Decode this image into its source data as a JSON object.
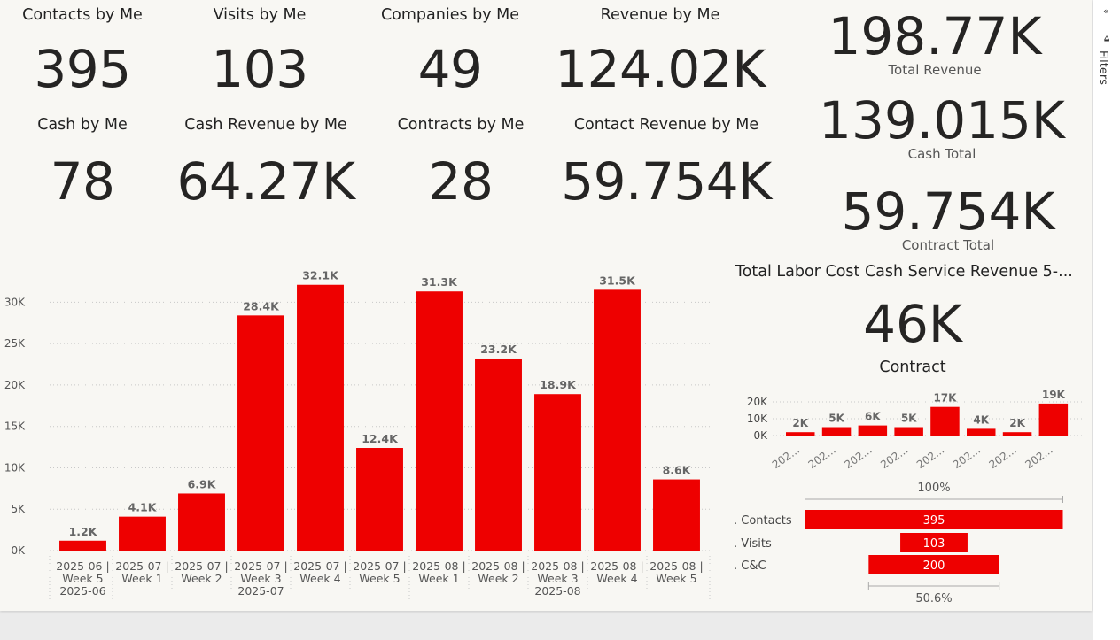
{
  "kpis": [
    {
      "title": "Contacts by Me",
      "value": "395"
    },
    {
      "title": "Visits by Me",
      "value": "103"
    },
    {
      "title": "Companies by Me",
      "value": "49"
    },
    {
      "title": "Revenue by Me",
      "value": "124.02K"
    },
    {
      "title": "Cash by Me",
      "value": "78"
    },
    {
      "title": "Cash Revenue by Me",
      "value": "64.27K"
    },
    {
      "title": "Contracts by Me",
      "value": "28"
    },
    {
      "title": "Contact Revenue by Me",
      "value": "59.754K"
    }
  ],
  "totals": [
    {
      "value": "198.77K",
      "label": "Total Revenue"
    },
    {
      "value": "139.015K",
      "label": "Cash Total"
    },
    {
      "value": "59.754K",
      "label": "Contract Total"
    }
  ],
  "side_visual": {
    "title": "Total Labor Cost Cash Service Revenue 5-...",
    "value": "46K",
    "subtitle": "Contract"
  },
  "filters_pane": {
    "label": "Filters",
    "collapse_icon": "chevron-left-icon",
    "funnel_icon": "funnel-icon"
  },
  "colors": {
    "bar": "#ee0000",
    "canvas": "#f8f7f3"
  },
  "chart_data": [
    {
      "type": "bar",
      "categories": [
        [
          "2025-06 |",
          "Week 5",
          "2025-06"
        ],
        [
          "2025-07 |",
          "Week 1"
        ],
        [
          "2025-07 |",
          "Week 2"
        ],
        [
          "2025-07 |",
          "Week 3",
          "2025-07"
        ],
        [
          "2025-07 |",
          "Week 4"
        ],
        [
          "2025-07 |",
          "Week 5"
        ],
        [
          "2025-08 |",
          "Week 1"
        ],
        [
          "2025-08 |",
          "Week 2"
        ],
        [
          "2025-08 |",
          "Week 3",
          "2025-08"
        ],
        [
          "2025-08 |",
          "Week 4"
        ],
        [
          "2025-08 |",
          "Week 5"
        ]
      ],
      "values": [
        1200,
        4100,
        6900,
        28400,
        32100,
        12400,
        31300,
        23200,
        18900,
        31500,
        8600
      ],
      "data_labels": [
        "1.2K",
        "4.1K",
        "6.9K",
        "28.4K",
        "32.1K",
        "12.4K",
        "31.3K",
        "23.2K",
        "18.9K",
        "31.5K",
        "8.6K"
      ],
      "yticks": [
        "0K",
        "5K",
        "10K",
        "15K",
        "20K",
        "25K",
        "30K"
      ],
      "ylim": [
        0,
        32500
      ],
      "grid": true
    },
    {
      "type": "bar",
      "categories": [
        "202...",
        "202...",
        "202...",
        "202...",
        "202...",
        "202...",
        "202...",
        "202..."
      ],
      "values": [
        2000,
        5000,
        6000,
        5000,
        17000,
        4000,
        2000,
        19000
      ],
      "data_labels": [
        "2K",
        "5K",
        "6K",
        "5K",
        "17K",
        "4K",
        "2K",
        "19K"
      ],
      "yticks": [
        "0K",
        "10K",
        "20K"
      ],
      "ylim": [
        0,
        20000
      ],
      "grid": true
    },
    {
      "type": "funnel",
      "categories": [
        ". Contacts",
        ". Visits",
        ". C&C"
      ],
      "values": [
        395,
        103,
        200
      ],
      "top_percent": "100%",
      "bottom_percent": "50.6%"
    }
  ]
}
